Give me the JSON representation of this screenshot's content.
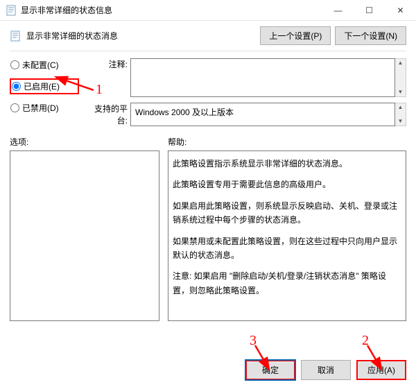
{
  "window": {
    "title": "显示非常详细的状态信息",
    "minimize": "—",
    "maximize": "☐",
    "close": "✕"
  },
  "header": {
    "title": "显示非常详细的状态消息",
    "prev_btn": "上一个设置(P)",
    "next_btn": "下一个设置(N)"
  },
  "radios": {
    "not_configured": "未配置(C)",
    "enabled": "已启用(E)",
    "disabled": "已禁用(D)"
  },
  "labels": {
    "comment": "注释:",
    "platform": "支持的平台:",
    "options": "选项:",
    "help": "帮助:"
  },
  "platform_value": "Windows 2000 及以上版本",
  "help_paragraphs": [
    "此策略设置指示系统显示非常详细的状态消息。",
    "此策略设置专用于需要此信息的高级用户。",
    "如果启用此策略设置，则系统显示反映启动、关机、登录或注销系统过程中每个步骤的状态消息。",
    "如果禁用或未配置此策略设置，则在这些过程中只向用户显示默认的状态消息。",
    "注意: 如果启用 \"删除启动/关机/登录/注销状态消息\" 策略设置，则忽略此策略设置。"
  ],
  "footer": {
    "ok": "确定",
    "cancel": "取消",
    "apply": "应用(A)"
  },
  "annotations": {
    "n1": "1",
    "n2": "2",
    "n3": "3"
  }
}
